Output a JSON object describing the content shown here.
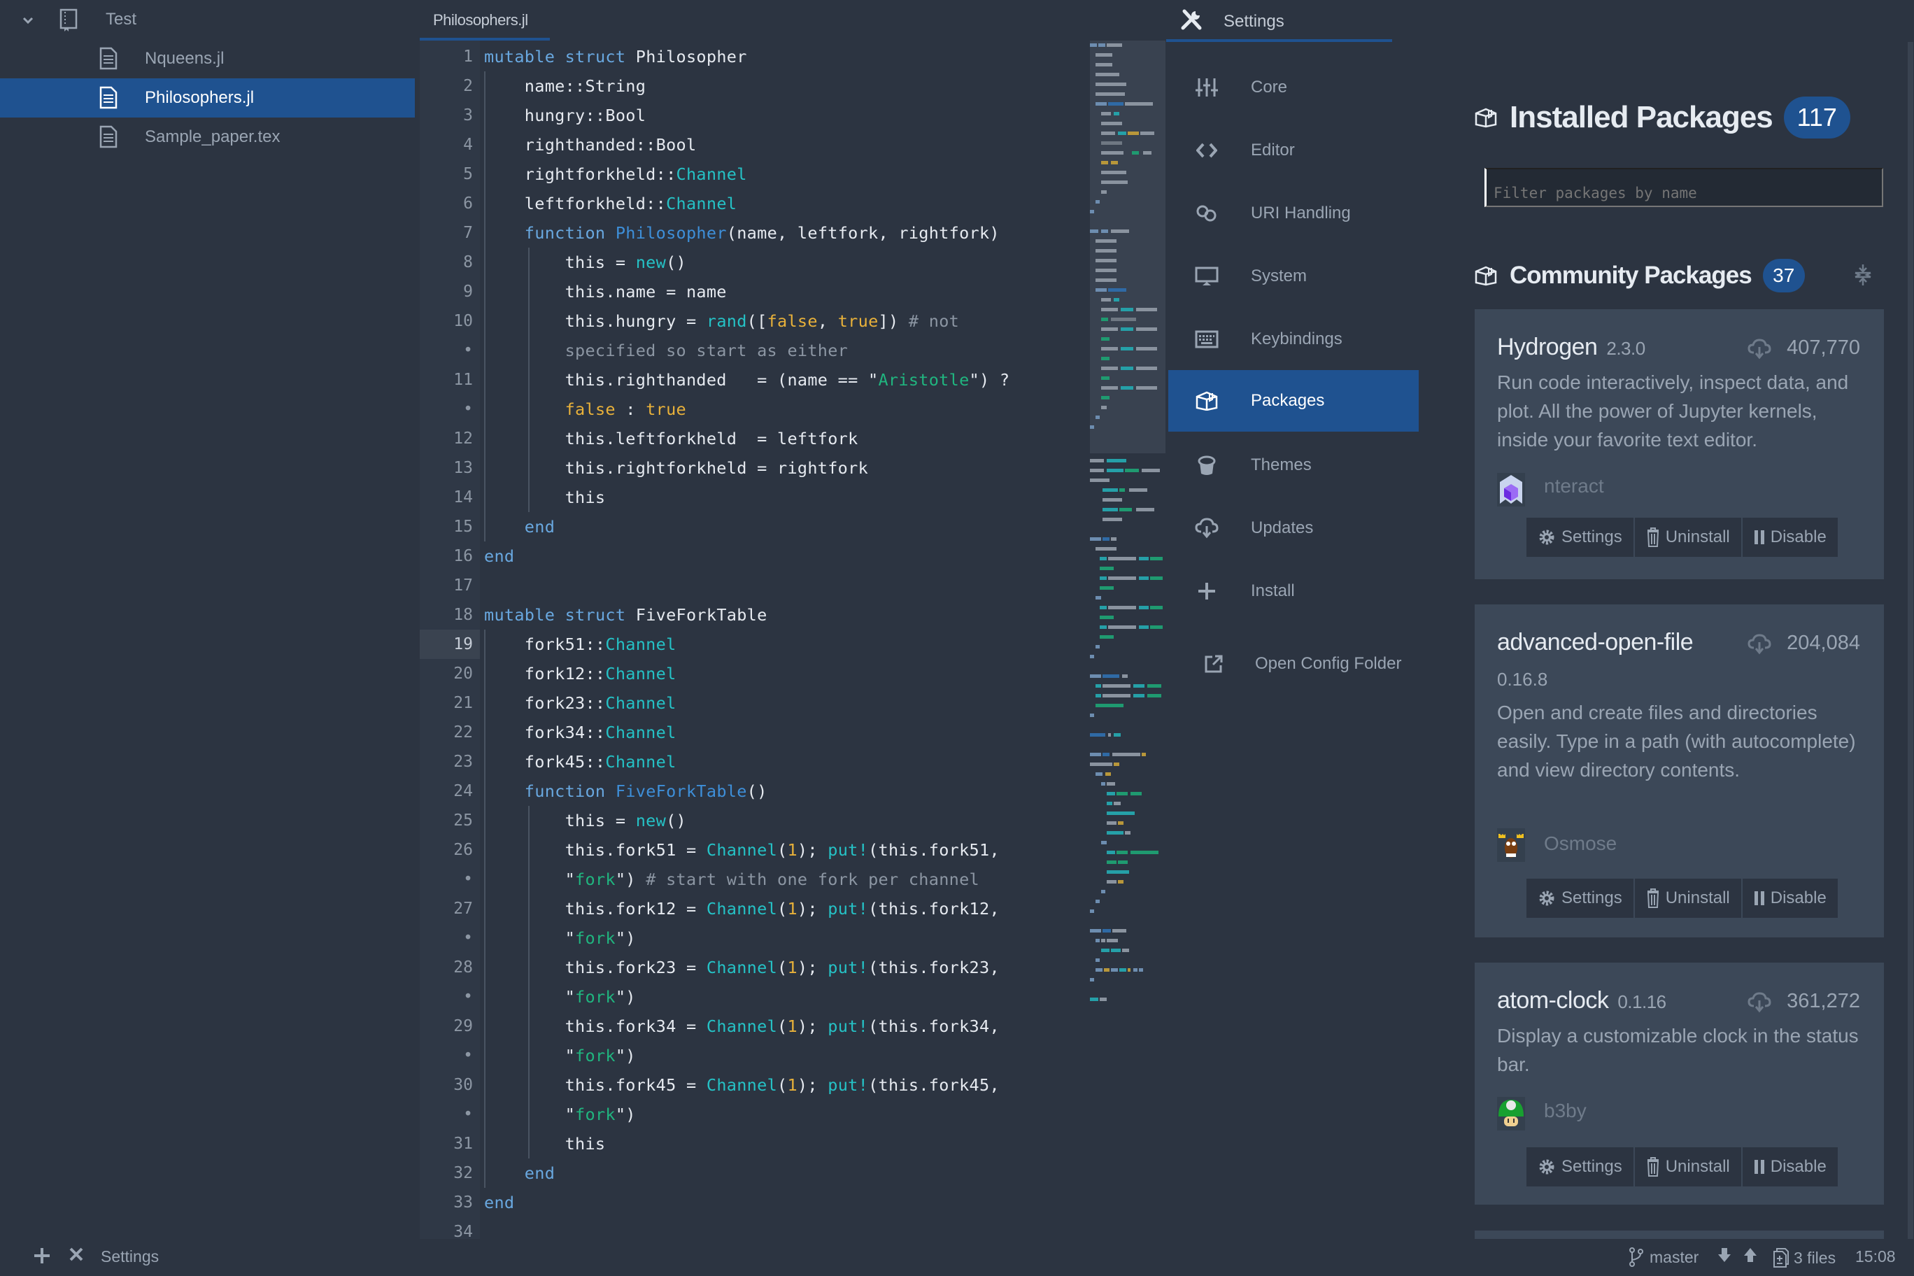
{
  "tree": {
    "root": {
      "label": "Test",
      "icon": "repo-icon",
      "expanded": true
    },
    "files": [
      {
        "label": "Nqueens.jl",
        "icon": "file-text-icon",
        "selected": false
      },
      {
        "label": "Philosophers.jl",
        "icon": "file-text-icon",
        "selected": true
      },
      {
        "label": "Sample_paper.tex",
        "icon": "file-text-icon",
        "selected": false
      }
    ]
  },
  "editor": {
    "tab_label": "Philosophers.jl",
    "current_line": 19,
    "gutter": [
      "1",
      "2",
      "3",
      "4",
      "5",
      "6",
      "7",
      "8",
      "9",
      "10",
      "•",
      "11",
      "•",
      "12",
      "13",
      "14",
      "15",
      "16",
      "17",
      "18",
      "19",
      "20",
      "21",
      "22",
      "23",
      "24",
      "25",
      "26",
      "•",
      "27",
      "•",
      "28",
      "•",
      "29",
      "•",
      "30",
      "•",
      "31",
      "32",
      "33",
      "34"
    ],
    "lines": [
      "mutable struct Philosopher",
      "    name::String",
      "    hungry::Bool",
      "    righthanded::Bool",
      "    rightforkheld::Channel",
      "    leftforkheld::Channel",
      "    function Philosopher(name, leftfork, rightfork)",
      "        this = new()",
      "        this.name = name",
      "        this.hungry = rand([false, true]) # not",
      "        specified so start as either",
      "        this.righthanded   = (name == \"Aristotle\") ?",
      "        false : true",
      "        this.leftforkheld  = leftfork",
      "        this.rightforkheld = rightfork",
      "        this",
      "    end",
      "end",
      "",
      "mutable struct FiveForkTable",
      "    fork51::Channel",
      "    fork12::Channel",
      "    fork23::Channel",
      "    fork34::Channel",
      "    fork45::Channel",
      "    function FiveForkTable()",
      "        this = new()",
      "        this.fork51 = Channel(1); put!(this.fork51,",
      "        \"fork\") # start with one fork per channel",
      "        this.fork12 = Channel(1); put!(this.fork12,",
      "        \"fork\")",
      "        this.fork23 = Channel(1); put!(this.fork23,",
      "        \"fork\")",
      "        this.fork34 = Channel(1); put!(this.fork34,",
      "        \"fork\")",
      "        this.fork45 = Channel(1); put!(this.fork45,",
      "        \"fork\")",
      "        this",
      "    end",
      "end",
      ""
    ]
  },
  "settings": {
    "tab_label": "Settings",
    "menu": [
      {
        "label": "Core",
        "icon": "sliders-icon",
        "active": false
      },
      {
        "label": "Editor",
        "icon": "code-icon",
        "active": false
      },
      {
        "label": "URI Handling",
        "icon": "link-icon",
        "active": false
      },
      {
        "label": "System",
        "icon": "monitor-icon",
        "active": false
      },
      {
        "label": "Keybindings",
        "icon": "keyboard-icon",
        "active": false
      },
      {
        "label": "Packages",
        "icon": "package-icon",
        "active": true
      },
      {
        "label": "Themes",
        "icon": "paintcan-icon",
        "active": false
      },
      {
        "label": "Updates",
        "icon": "cloud-download-icon",
        "active": false
      },
      {
        "label": "Install",
        "icon": "plus-icon",
        "active": false
      }
    ],
    "open_config": "Open Config Folder"
  },
  "packages": {
    "installed_title": "Installed Packages",
    "installed_count": "117",
    "filter_placeholder": "Filter packages by name",
    "community_title": "Community Packages",
    "community_count": "37",
    "cards": [
      {
        "name": "Hydrogen",
        "version": "2.3.0",
        "downloads": "407,770",
        "description": "Run code interactively, inspect data, and plot. All the power of Jupyter kernels, inside your favorite text editor.",
        "author": "nteract",
        "buttons": [
          "Settings",
          "Uninstall",
          "Disable"
        ]
      },
      {
        "name": "advanced-open-file",
        "version": "0.16.8",
        "downloads": "204,084",
        "description": "Open and create files and directories easily. Type in a path (with autocomplete) and view directory contents.",
        "author": "Osmose",
        "buttons": [
          "Settings",
          "Uninstall",
          "Disable"
        ]
      },
      {
        "name": "atom-clock",
        "version": "0.1.16",
        "downloads": "361,272",
        "description": "Display a customizable clock in the status bar.",
        "author": "b3by",
        "buttons": [
          "Settings",
          "Uninstall",
          "Disable"
        ]
      }
    ]
  },
  "statusbar": {
    "left_label": "Settings",
    "branch": "master",
    "files": "3 files",
    "time": "15:08"
  },
  "colors": {
    "background": "#2c3441",
    "accent": "#1f5290",
    "keyword": "#69a8e0",
    "builtin": "#25c2c6",
    "constant": "#e8b13a",
    "string": "#20b57f",
    "comment": "#8c96a3"
  }
}
